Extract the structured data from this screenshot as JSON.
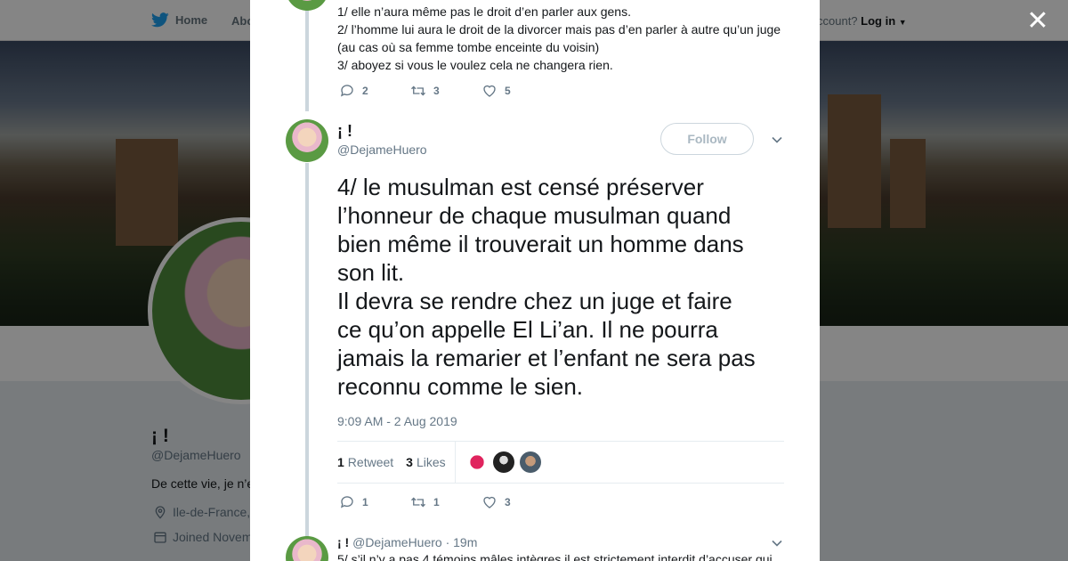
{
  "topnav": {
    "home_label": "Home",
    "about_label": "Abo",
    "login_prefix": "ccount?",
    "login_label": "Log in"
  },
  "profile": {
    "name": "¡ !",
    "handle": "@DejameHuero",
    "bio": "De cette vie, je n’e",
    "location": "Ile-de-France,",
    "joined": "Joined Novem"
  },
  "previous_tweet": {
    "lines": [
      "1/ elle n’aura même pas le droit d’en parler aux gens.",
      "2/ l’homme lui aura le droit de la divorcer mais pas d’en parler à autre qu’un juge",
      "(au cas où sa femme tombe enceinte du voisin)",
      "3/ aboyez si vous le voulez cela ne changera rien."
    ],
    "replies": "2",
    "retweets": "3",
    "likes": "5"
  },
  "main_tweet": {
    "name": "¡ !",
    "handle": "@DejameHuero",
    "follow_label": "Follow",
    "text_lines": [
      "4/ le musulman est censé préserver",
      "l’honneur de chaque musulman quand",
      "bien même il trouverait un homme dans",
      "son lit.",
      "Il devra se rendre chez un juge et faire",
      "ce qu’on appelle El Li’an. Il ne pourra",
      "jamais la remarier et l’enfant ne sera pas",
      "reconnu comme le sien."
    ],
    "timestamp": "9:09 AM - 2 Aug 2019",
    "retweet_count": "1",
    "retweet_label": "Retweet",
    "like_count": "3",
    "like_label": "Likes",
    "replies": "1",
    "retweets": "1",
    "likes": "3"
  },
  "reply_tweet": {
    "name": "¡ !",
    "handle": "@DejameHuero",
    "time": "· 19m",
    "text": "5/ s’il n’y a pas 4 témoins mâles intègres il est strictement interdit d’accuser qui"
  },
  "colors": {
    "brand": "#1da1f2",
    "text": "#14171a",
    "muted": "#657786",
    "border": "#e6ecf0",
    "thread": "#ccd6dd"
  }
}
